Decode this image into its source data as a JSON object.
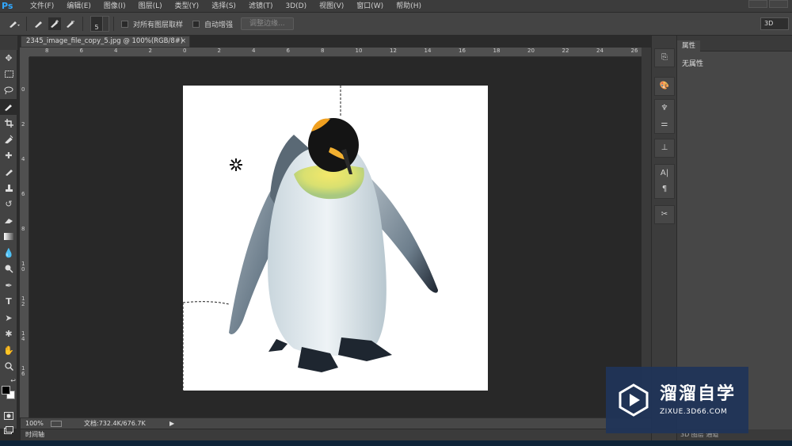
{
  "app": {
    "logo": "Ps"
  },
  "menu": [
    "文件(F)",
    "编辑(E)",
    "图像(I)",
    "图层(L)",
    "类型(Y)",
    "选择(S)",
    "滤镜(T)",
    "3D(D)",
    "视图(V)",
    "窗口(W)",
    "帮助(H)"
  ],
  "options": {
    "brush_size": "5",
    "sample_all_layers": "对所有图层取样",
    "auto_enhance": "自动增强",
    "refine_edge": "调整边缘...",
    "workspace": "3D"
  },
  "document": {
    "tab_title": "2345_image_file_copy_5.jpg @ 100%(RGB/8#)",
    "tab_close": "×"
  },
  "ruler": {
    "top": [
      "8",
      "6",
      "4",
      "2",
      "0",
      "2",
      "4",
      "6",
      "8",
      "10",
      "12",
      "14",
      "16",
      "18",
      "20",
      "22",
      "24",
      "26"
    ],
    "left": [
      "0",
      "2",
      "4",
      "6",
      "8",
      "1 0",
      "1 2",
      "1 4",
      "1 6"
    ]
  },
  "status": {
    "zoom": "100%",
    "doc_info": "文档:732.4K/676.7K",
    "arrow": "▶"
  },
  "timeline": "时间轴",
  "panel": {
    "tab": "属性",
    "body": "无属性",
    "bottom_tabs": "3D   图层   通道"
  },
  "watermark": {
    "brand": "溜溜自学",
    "url": "ZIXUE.3D66.COM"
  },
  "colors": {
    "accent": "#31a8ff",
    "watermark_bg": "#203458"
  }
}
